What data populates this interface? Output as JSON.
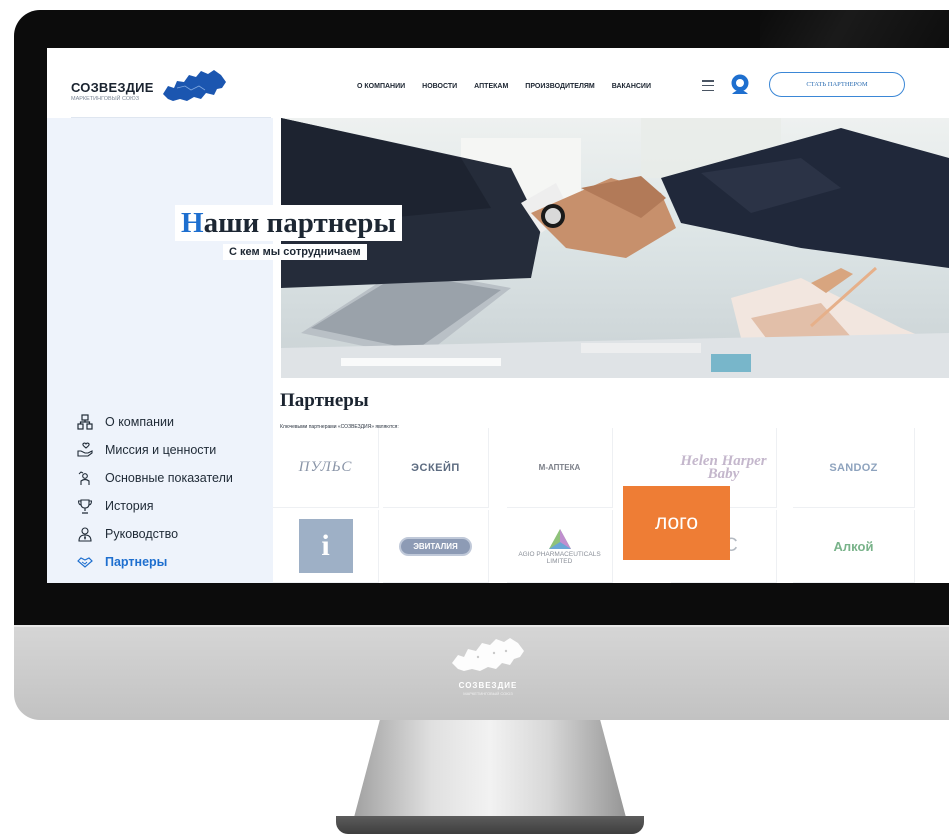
{
  "header": {
    "brand_name": "СОЗВЕЗДИЕ",
    "brand_sub": "МАРКЕТИНГОВЫЙ СОЮЗ",
    "nav": [
      "О КОМПАНИИ",
      "НОВОСТИ",
      "АПТЕКАМ",
      "ПРОИЗВОДИТЕЛЯМ",
      "ВАКАНСИИ"
    ],
    "cta_label": "СТАТЬ ПАРТНЕРОМ"
  },
  "hero": {
    "title_first": "Н",
    "title_rest": "аши партнеры",
    "subtitle": "С кем мы сотрудничаем"
  },
  "sidebar": {
    "items": [
      {
        "label": "О компании",
        "icon": "org-chart-icon",
        "active": false
      },
      {
        "label": "Миссия и ценности",
        "icon": "hand-heart-icon",
        "active": false
      },
      {
        "label": "Основные показатели",
        "icon": "chart-person-icon",
        "active": false
      },
      {
        "label": "История",
        "icon": "trophy-icon",
        "active": false
      },
      {
        "label": "Руководство",
        "icon": "leader-icon",
        "active": false
      },
      {
        "label": "Партнеры",
        "icon": "handshake-icon",
        "active": true
      }
    ]
  },
  "partners": {
    "title": "Партнеры",
    "description": "Ключевыми партнерами «СОЗВЕЗДИЯ» являются:",
    "logos_row1": [
      "ПУЛЬС",
      "ЭСКЕЙП",
      "М-АПТЕКА",
      "Helen Harper Baby",
      "SANDOZ"
    ],
    "logos_row2": [
      "i",
      "ЭВИТАЛИЯ",
      "AGIO PHARMACEUTICALS LIMITED",
      "OC",
      "Алкой"
    ]
  },
  "overlay": {
    "logo_label": "лого"
  },
  "monitor": {
    "chin_brand": "СОЗВЕЗДИЕ",
    "chin_sub": "МАРКЕТИНГОВЫЙ СОЮЗ"
  },
  "colors": {
    "accent": "#1e6fcf",
    "logo_badge": "#ee7d35",
    "bezel": "#0c0c0c"
  }
}
